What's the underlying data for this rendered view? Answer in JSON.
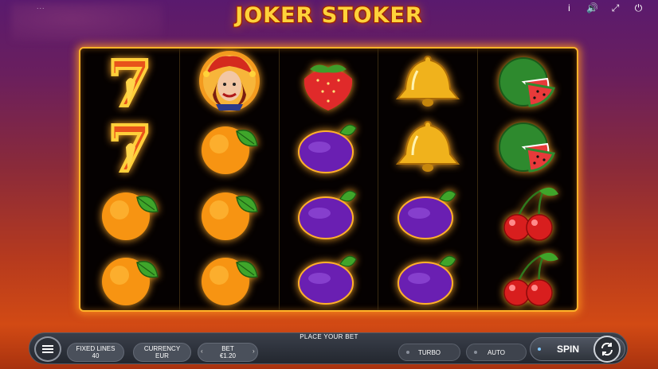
{
  "branding": {
    "provider_text": "...",
    "game_title": "JOKER STOKER"
  },
  "top_controls": {
    "info": "i",
    "sound": "🔊",
    "fullscreen": "⤢",
    "power": "⏻"
  },
  "reels": [
    [
      "seven",
      "seven",
      "orange",
      "orange"
    ],
    [
      "joker",
      "orange",
      "orange",
      "orange"
    ],
    [
      "strawberry",
      "plum",
      "plum",
      "plum"
    ],
    [
      "bell",
      "bell",
      "plum",
      "plum"
    ],
    [
      "watermelon",
      "watermelon",
      "cherries",
      "cherries"
    ]
  ],
  "bottom_bar": {
    "status": "PLACE YOUR BET",
    "fixed_lines_label": "FIXED LINES",
    "fixed_lines_value": "40",
    "currency_label": "CURRENCY",
    "currency_value": "EUR",
    "bet_label": "BET",
    "bet_value": "€1.20",
    "bet_decrease": "‹",
    "bet_increase": "›",
    "turbo_label": "TURBO",
    "auto_label": "AUTO",
    "spin_label": "SPIN"
  }
}
